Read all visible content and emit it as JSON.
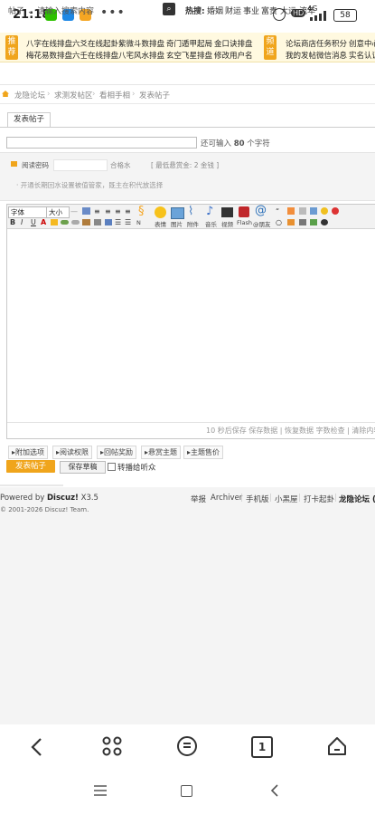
{
  "status_bar": {
    "time": "21:18",
    "dots": "•••",
    "network": "4G",
    "hd": "HD",
    "battery": "58"
  },
  "ads": {
    "left_tag": "推荐",
    "right_tag": "频道",
    "row1": [
      "八字在线排盘",
      "六爻在线起卦",
      "紫微斗数排盘",
      "奇门遁甲起局",
      "金口诀排盘"
    ],
    "row2": [
      "梅花易数排盘",
      "六壬在线排盘",
      "八宅风水排盘",
      "玄空飞星排盘",
      "修改用户名"
    ],
    "right_row1": [
      "论坛商店",
      "任务积分",
      "创意中心"
    ],
    "right_row2": [
      "我的发帖",
      "微信消息",
      "实名认证"
    ]
  },
  "search": {
    "scope": "帖子 ⌄",
    "placeholder": "请输入搜索内容",
    "hot_label": "热搜:",
    "hot_words": [
      "婚姻",
      "财运",
      "事业",
      "富贵",
      "大运",
      "流年"
    ]
  },
  "breadcrumb": [
    "龙隐论坛",
    "求测发帖区",
    "看相手相",
    "发表帖子"
  ],
  "tab": "发表帖子",
  "title_field": {
    "hint_prefix": "还可输入",
    "count": "80",
    "hint_suffix": "个字符"
  },
  "info": {
    "read_pwd": "阅读密码",
    "pwd_help": "合格水",
    "min_reply": "[ 最低悬赏金: 2 金钱 ]",
    "note": "· 开通长期回水设置被值管家，既主在积代放选择"
  },
  "editor": {
    "font_select": "字体",
    "size_select": "大小",
    "tool_labels": [
      "加粗",
      "斜体",
      "下划线",
      "颜色",
      "背景",
      "链接"
    ],
    "big_tools": [
      {
        "icon": "smile-icon",
        "label": "表情"
      },
      {
        "icon": "image-icon",
        "label": "图片"
      },
      {
        "icon": "attach-icon",
        "label": "附件"
      },
      {
        "icon": "music-icon",
        "label": "音乐"
      },
      {
        "icon": "video-icon",
        "label": "视频"
      },
      {
        "icon": "flash-icon",
        "label": "Flash"
      },
      {
        "icon": "at-icon",
        "label": "@朋友"
      }
    ],
    "n_label": "N",
    "footer": "10 秒后保存  保存数据 | 恢复数据    字数检查 | 清除内容"
  },
  "options": [
    "附加选项",
    "阅读权限",
    "回帖奖励",
    "悬赏主题",
    "主题售价"
  ],
  "buttons": {
    "post": "发表帖子",
    "draft": "保存草稿",
    "checkbox": "转播给听众"
  },
  "footer": {
    "powered_prefix": "Powered by",
    "brand": "Discuz!",
    "version": "X3.5",
    "links": [
      "举报",
      "Archiver",
      "手机版",
      "小黑屋",
      "打卡起卦",
      "龙隐论坛 ("
    ],
    "copyright": "© 2001-2026 Discuz! Team."
  },
  "nav": {
    "page_count": "1"
  },
  "colors": {
    "accent": "#f0a51c",
    "adbar_bg": "#fff9e0"
  }
}
